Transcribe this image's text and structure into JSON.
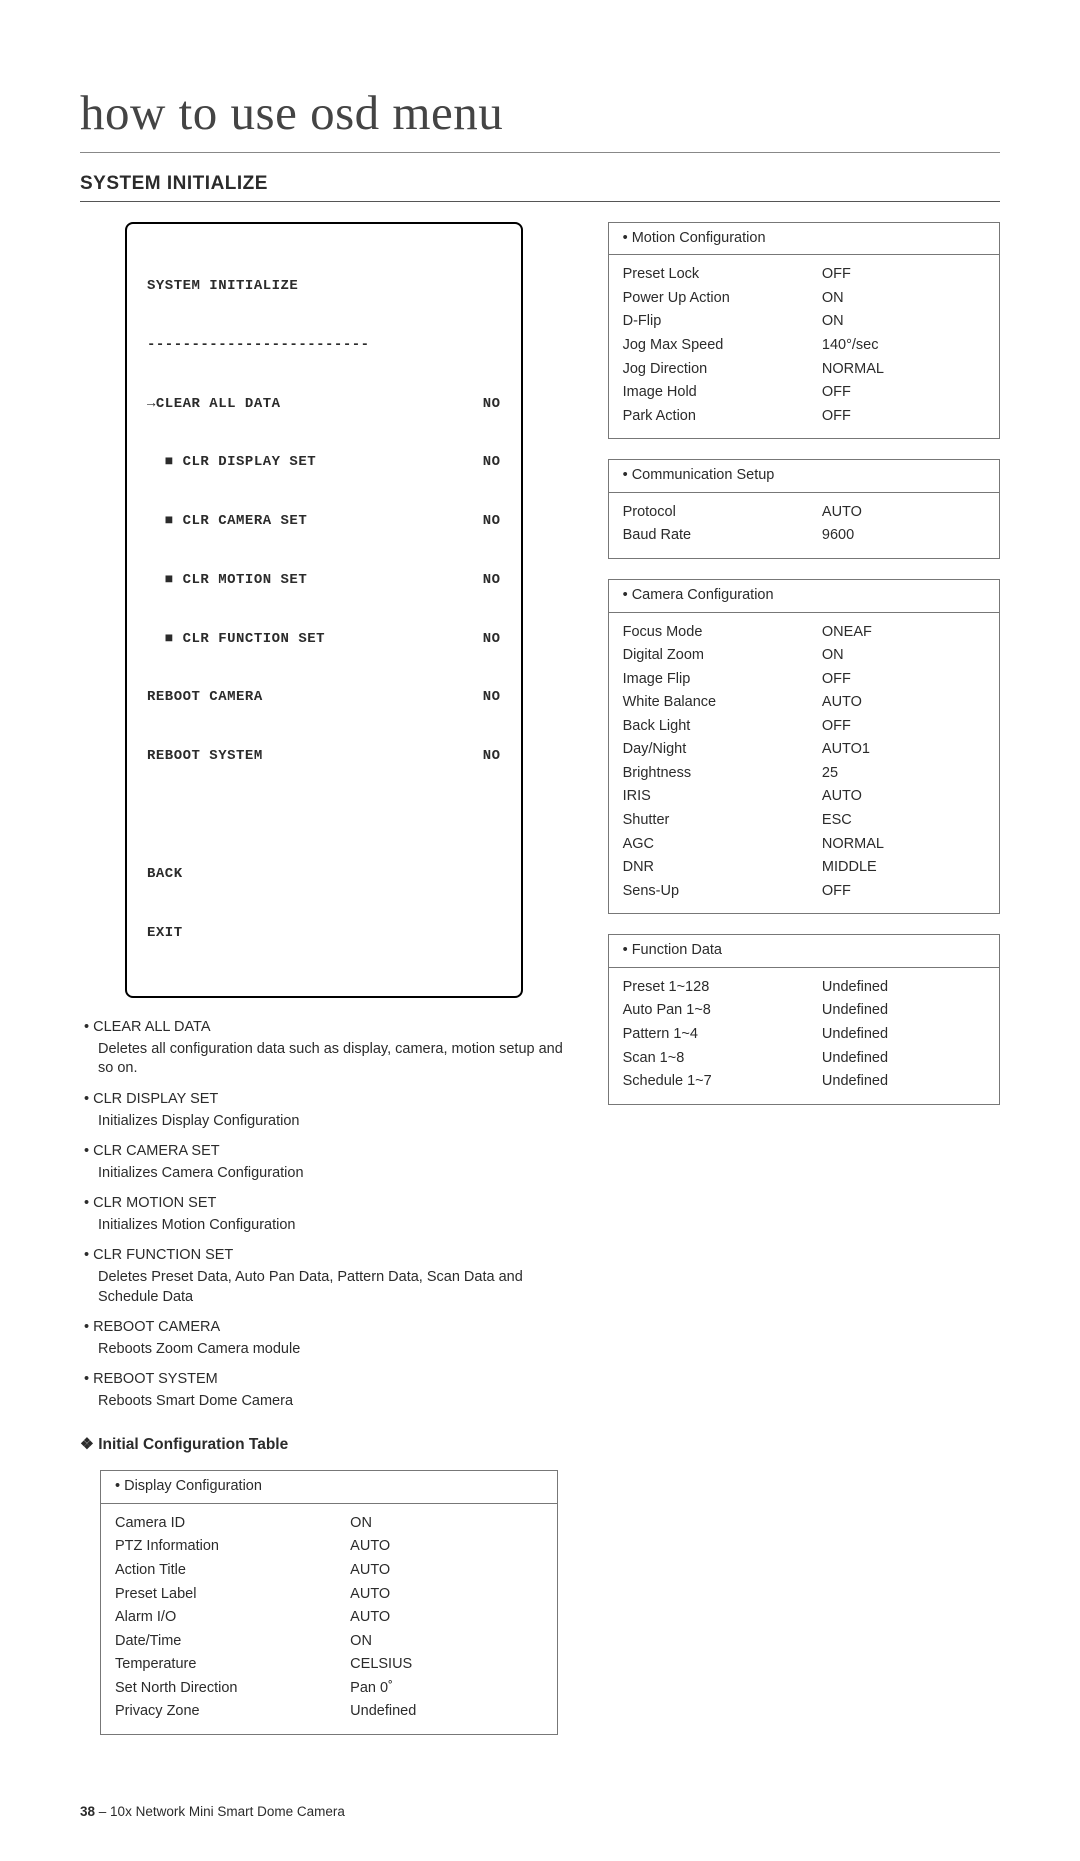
{
  "page_title": "how to use osd menu",
  "section_title": "SYSTEM INITIALIZE",
  "osd": {
    "title": "SYSTEM INITIALIZE",
    "rule": "-------------------------",
    "items": [
      {
        "name": "→CLEAR ALL DATA",
        "val": "NO"
      },
      {
        "name": "  ■ CLR DISPLAY SET",
        "val": "NO"
      },
      {
        "name": "  ■ CLR CAMERA SET",
        "val": "NO"
      },
      {
        "name": "  ■ CLR MOTION SET",
        "val": "NO"
      },
      {
        "name": "  ■ CLR FUNCTION SET",
        "val": "NO"
      },
      {
        "name": "REBOOT CAMERA",
        "val": "NO"
      },
      {
        "name": "REBOOT SYSTEM",
        "val": "NO"
      }
    ],
    "footer": [
      "BACK",
      "EXIT"
    ]
  },
  "desc": [
    {
      "head": "CLEAR ALL DATA",
      "body": "Deletes all configuration data such as display, camera, motion setup and so on."
    },
    {
      "head": "CLR DISPLAY SET",
      "body": "Initializes Display Configuration"
    },
    {
      "head": "CLR CAMERA SET",
      "body": "Initializes Camera Configuration"
    },
    {
      "head": "CLR MOTION SET",
      "body": "Initializes Motion Configuration"
    },
    {
      "head": "CLR FUNCTION SET",
      "body": "Deletes Preset Data, Auto Pan Data, Pattern Data, Scan Data and Schedule Data"
    },
    {
      "head": "REBOOT CAMERA",
      "body": "Reboots Zoom Camera module"
    },
    {
      "head": "REBOOT SYSTEM",
      "body": "Reboots Smart Dome Camera"
    }
  ],
  "subhead": "Initial Configuration Table",
  "tables": {
    "display": {
      "title": "Display Configuration",
      "rows": [
        {
          "k": "Camera ID",
          "v": "ON"
        },
        {
          "k": "PTZ Information",
          "v": "AUTO"
        },
        {
          "k": "Action Title",
          "v": "AUTO"
        },
        {
          "k": "Preset Label",
          "v": "AUTO"
        },
        {
          "k": "Alarm I/O",
          "v": "AUTO"
        },
        {
          "k": "Date/Time",
          "v": "ON"
        },
        {
          "k": "Temperature",
          "v": "CELSIUS"
        },
        {
          "k": "Set North Direction",
          "v": "Pan 0˚"
        },
        {
          "k": "Privacy Zone",
          "v": "Undefined"
        }
      ]
    },
    "motion": {
      "title": "Motion Configuration",
      "rows": [
        {
          "k": "Preset Lock",
          "v": "OFF"
        },
        {
          "k": "Power Up Action",
          "v": "ON"
        },
        {
          "k": "D-Flip",
          "v": "ON"
        },
        {
          "k": "Jog Max Speed",
          "v": "140°/sec"
        },
        {
          "k": "Jog Direction",
          "v": "NORMAL"
        },
        {
          "k": "Image Hold",
          "v": "OFF"
        },
        {
          "k": "Park Action",
          "v": "OFF"
        }
      ]
    },
    "comm": {
      "title": "Communication Setup",
      "rows": [
        {
          "k": "Protocol",
          "v": "AUTO"
        },
        {
          "k": "Baud Rate",
          "v": "9600"
        }
      ]
    },
    "camera": {
      "title": "Camera Configuration",
      "rows": [
        {
          "k": "Focus Mode",
          "v": "ONEAF"
        },
        {
          "k": "Digital Zoom",
          "v": "ON"
        },
        {
          "k": "Image Flip",
          "v": "OFF"
        },
        {
          "k": "White Balance",
          "v": "AUTO"
        },
        {
          "k": "Back Light",
          "v": "OFF"
        },
        {
          "k": "Day/Night",
          "v": "AUTO1"
        },
        {
          "k": "Brightness",
          "v": "25"
        },
        {
          "k": "IRIS",
          "v": "AUTO"
        },
        {
          "k": "Shutter",
          "v": "ESC"
        },
        {
          "k": "AGC",
          "v": "NORMAL"
        },
        {
          "k": "DNR",
          "v": "MIDDLE"
        },
        {
          "k": "Sens-Up",
          "v": "OFF"
        }
      ]
    },
    "func": {
      "title": "Function Data",
      "rows": [
        {
          "k": "Preset 1~128",
          "v": "Undefined"
        },
        {
          "k": "Auto Pan 1~8",
          "v": "Undefined"
        },
        {
          "k": "Pattern 1~4",
          "v": "Undefined"
        },
        {
          "k": "Scan 1~8",
          "v": "Undefined"
        },
        {
          "k": "Schedule 1~7",
          "v": "Undefined"
        }
      ]
    }
  },
  "footer": {
    "page": "38",
    "sep": " – ",
    "label": "10x Network Mini Smart Dome Camera"
  }
}
